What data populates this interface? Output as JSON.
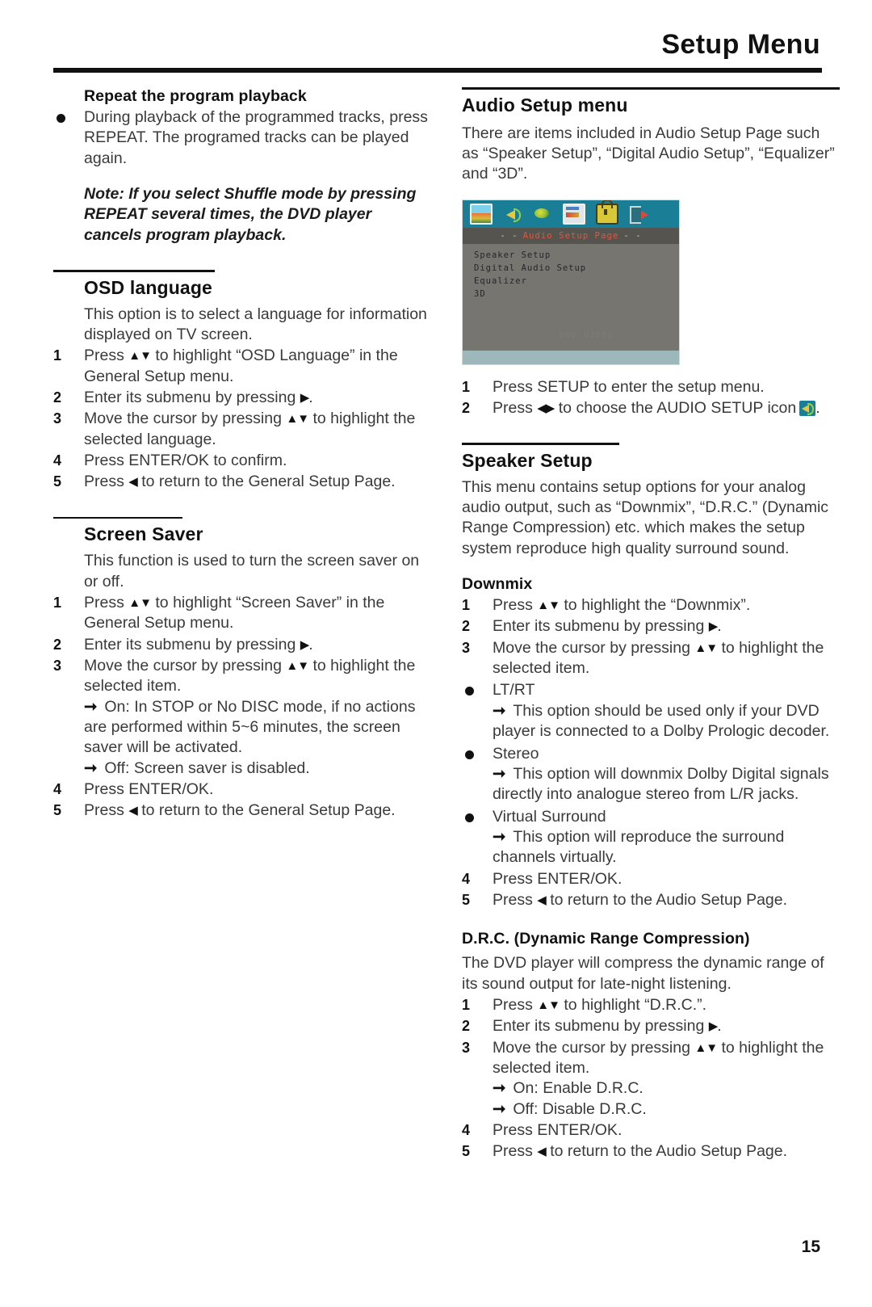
{
  "header": {
    "title": "Setup Menu"
  },
  "page_number": "15",
  "left_column": {
    "repeat": {
      "heading": "Repeat the program playback",
      "bullet": "During playback of the programmed tracks, press REPEAT. The programed tracks can be played again.",
      "note": "Note: If you select Shuffle mode by pressing REPEAT several times, the DVD player cancels program playback."
    },
    "osd": {
      "heading": "OSD language",
      "intro": "This option is to select a language for information displayed on TV screen.",
      "steps": [
        {
          "num": "1",
          "text_before": "Press ",
          "keys": "▲▼",
          "text_after": " to highlight “OSD Language” in the General Setup menu."
        },
        {
          "num": "2",
          "text_before": "Enter its submenu by pressing ",
          "keys": "▶",
          "text_after": "."
        },
        {
          "num": "3",
          "text_before": "Move the cursor by pressing ",
          "keys": "▲▼",
          "text_after": " to highlight the selected language."
        },
        {
          "num": "4",
          "text_before": "Press ENTER/OK to confirm.",
          "keys": "",
          "text_after": ""
        },
        {
          "num": "5",
          "text_before": "Press ",
          "keys": "◀",
          "text_after": " to return to the General Setup Page."
        }
      ]
    },
    "screensaver": {
      "heading": "Screen Saver",
      "intro": "This function is used to turn the screen saver on or off.",
      "steps": [
        {
          "num": "1",
          "text_before": "Press ",
          "keys": "▲▼",
          "text_after": " to highlight “Screen Saver” in the General Setup menu."
        },
        {
          "num": "2",
          "text_before": "Enter its submenu by pressing ",
          "keys": "▶",
          "text_after": "."
        },
        {
          "num": "3",
          "text_before": "Move the cursor by pressing ",
          "keys": "▲▼",
          "text_after": " to highlight the selected item."
        }
      ],
      "arrow_items": [
        "On: In STOP or No DISC mode, if no actions are performed within 5~6 minutes, the screen saver will be activated.",
        "Off: Screen saver is disabled."
      ],
      "steps_tail": [
        {
          "num": "4",
          "text_before": "Press ENTER/OK.",
          "keys": "",
          "text_after": ""
        },
        {
          "num": "5",
          "text_before": "Press ",
          "keys": "◀",
          "text_after": " to return to the General Setup Page."
        }
      ]
    }
  },
  "right_column": {
    "audio_setup": {
      "heading": "Audio Setup menu",
      "intro": "There are items included in Audio Setup Page such as “Speaker Setup”, “Digital Audio Setup”, “Equalizer” and “3D”.",
      "steps": [
        {
          "num": "1",
          "text_before": "Press SETUP to enter the setup menu.",
          "keys": "",
          "text_after": ""
        },
        {
          "num": "2",
          "text_before": "Press ",
          "keys": "◀▶",
          "text_after": " to choose the AUDIO SETUP icon"
        }
      ]
    },
    "screenshot": {
      "icons": [
        "general-setup-picture-icon",
        "audio-setup-speaker-icon",
        "video-setup-disc-icon",
        "preference-setup-icon",
        "password-lock-icon",
        "exit-setup-icon"
      ],
      "title_dashes_left": "- -",
      "title": "Audio Setup Page",
      "title_dashes_right": "- -",
      "menu_items": [
        "Speaker Setup",
        "Digital Audio Setup",
        "Equalizer",
        "3D"
      ],
      "ghost_text": "DVD VIDEO"
    },
    "speaker_setup": {
      "heading": "Speaker Setup",
      "intro": "This menu contains setup options for your analog audio output, such as “Downmix”, “D.R.C.” (Dynamic Range Compression) etc. which makes the setup system reproduce high quality surround sound."
    },
    "downmix": {
      "heading": "Downmix",
      "steps": [
        {
          "num": "1",
          "text_before": "Press ",
          "keys": "▲▼",
          "text_after": " to highlight the “Downmix”."
        },
        {
          "num": "2",
          "text_before": "Enter its submenu by pressing ",
          "keys": "▶",
          "text_after": "."
        },
        {
          "num": "3",
          "text_before": "Move the cursor by pressing ",
          "keys": "▲▼",
          "text_after": " to highlight the selected item."
        }
      ],
      "options": [
        {
          "label": "LT/RT",
          "desc": "This option should be used only if your DVD player is connected to a Dolby Prologic decoder."
        },
        {
          "label": "Stereo",
          "desc": "This option will downmix Dolby Digital signals directly into analogue stereo from L/R jacks."
        },
        {
          "label": "Virtual Surround",
          "desc": "This option will reproduce the surround channels virtually."
        }
      ],
      "steps_tail": [
        {
          "num": "4",
          "text_before": "Press ENTER/OK.",
          "keys": "",
          "text_after": ""
        },
        {
          "num": "5",
          "text_before": "Press ",
          "keys": "◀",
          "text_after": " to return to the Audio Setup Page."
        }
      ]
    },
    "drc": {
      "heading": "D.R.C. (Dynamic Range Compression)",
      "intro": "The DVD player will compress the dynamic range of its sound output for late-night listening.",
      "steps": [
        {
          "num": "1",
          "text_before": "Press ",
          "keys": "▲▼",
          "text_after": " to highlight “D.R.C.”."
        },
        {
          "num": "2",
          "text_before": "Enter its submenu by pressing ",
          "keys": "▶",
          "text_after": "."
        },
        {
          "num": "3",
          "text_before": "Move the cursor by pressing ",
          "keys": "▲▼",
          "text_after": " to highlight the selected item."
        }
      ],
      "arrow_items": [
        "On: Enable D.R.C.",
        "Off: Disable D.R.C."
      ],
      "steps_tail": [
        {
          "num": "4",
          "text_before": "Press ENTER/OK.",
          "keys": "",
          "text_after": ""
        },
        {
          "num": "5",
          "text_before": "Press ",
          "keys": "◀",
          "text_after": " to return to the Audio Setup Page."
        }
      ]
    }
  }
}
